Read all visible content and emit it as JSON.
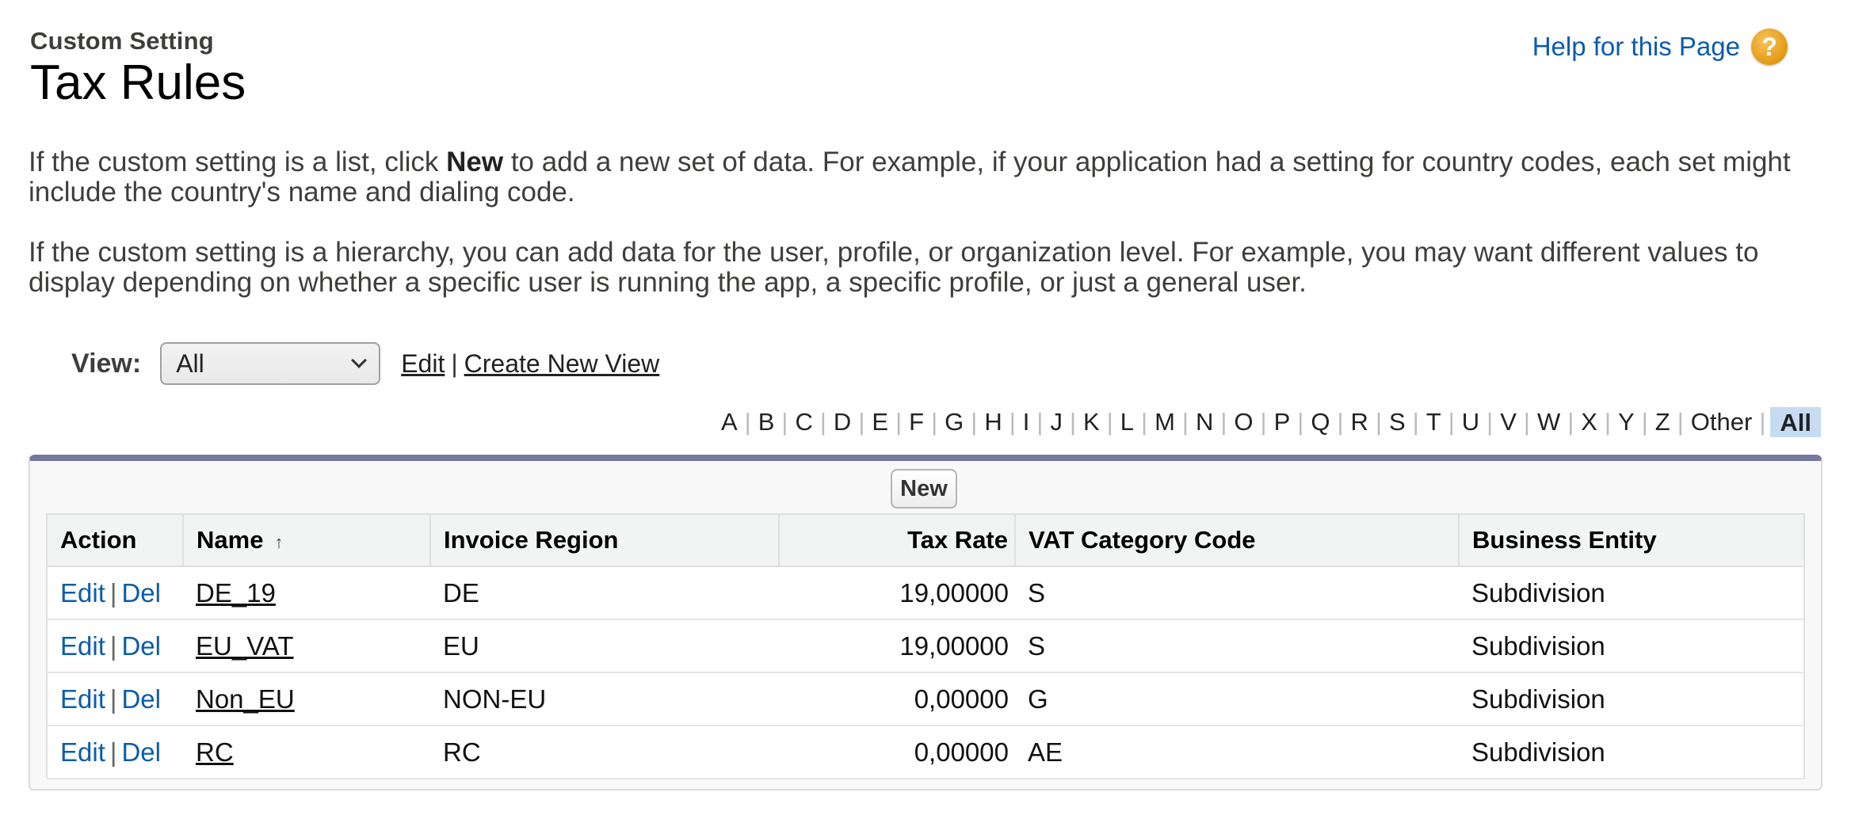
{
  "header": {
    "subtitle": "Custom Setting",
    "title": "Tax Rules",
    "help_link": "Help for this Page",
    "help_icon": "?"
  },
  "intro": {
    "p1_before": "If the custom setting is a list, click ",
    "p1_bold": "New",
    "p1_after": " to add a new set of data. For example, if your application had a setting for country codes, each set might include the country's name and dialing code.",
    "p2": "If the custom setting is a hierarchy, you can add data for the user, profile, or organization level. For example, you may want different values to display depending on whether a specific user is running the app, a specific profile, or just a general user."
  },
  "view": {
    "label": "View:",
    "selected": "All",
    "edit_link": "Edit",
    "separator": "|",
    "create_link": "Create New View"
  },
  "alpha": {
    "letters": [
      "A",
      "B",
      "C",
      "D",
      "E",
      "F",
      "G",
      "H",
      "I",
      "J",
      "K",
      "L",
      "M",
      "N",
      "O",
      "P",
      "Q",
      "R",
      "S",
      "T",
      "U",
      "V",
      "W",
      "X",
      "Y",
      "Z",
      "Other"
    ],
    "selected": "All"
  },
  "table": {
    "new_button": "New",
    "columns": {
      "action": "Action",
      "name": "Name",
      "name_sort_icon": "↑",
      "invoice_region": "Invoice Region",
      "tax_rate": "Tax Rate",
      "vat_category_code": "VAT Category Code",
      "business_entity": "Business Entity"
    },
    "edit_label": "Edit",
    "del_label": "Del",
    "action_separator": "|",
    "rows": [
      {
        "name": "DE_19",
        "region": "DE",
        "rate": "19,00000",
        "vat": "S",
        "entity": "Subdivision"
      },
      {
        "name": "EU_VAT",
        "region": "EU",
        "rate": "19,00000",
        "vat": "S",
        "entity": "Subdivision"
      },
      {
        "name": "Non_EU",
        "region": "NON-EU",
        "rate": "0,00000",
        "vat": "G",
        "entity": "Subdivision"
      },
      {
        "name": "RC",
        "region": "RC",
        "rate": "0,00000",
        "vat": "AE",
        "entity": "Subdivision"
      }
    ]
  },
  "colors": {
    "link_blue": "#0b5cab",
    "panel_top_bar": "#75799a",
    "alpha_selected_bg": "#c5dcf3",
    "help_icon": "#e39a12"
  }
}
